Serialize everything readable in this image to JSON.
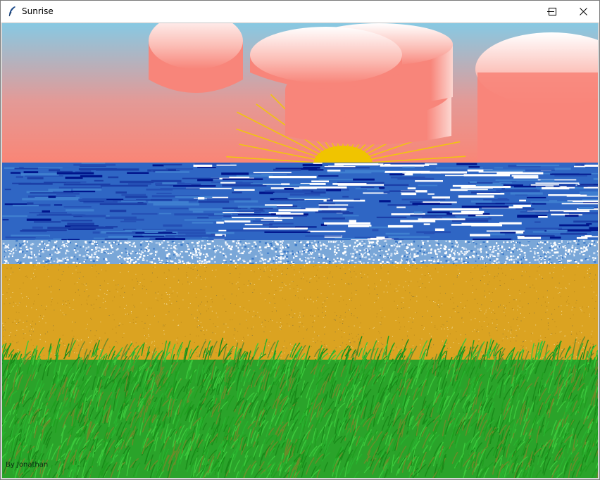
{
  "window": {
    "title": "Sunrise",
    "icon": "feather-icon",
    "controls": [
      "minimize-icon",
      "maximize-icon",
      "close-icon"
    ]
  },
  "scene": {
    "credit": "By Jonathan",
    "colors": {
      "sky_top": "#87c9e3",
      "sky_bottom": "#fa8575",
      "cloud": "#f8857a",
      "sun": "#f0c400",
      "sun_rays": "#f1c40f",
      "ocean": "#2f66c4",
      "ocean_dark": "#00158c",
      "foam": "#ffffff",
      "sand": "#dba321",
      "grass": "#29b32f",
      "grass_dark": "#198a19",
      "grass_olive": "#6f8a2a"
    }
  }
}
